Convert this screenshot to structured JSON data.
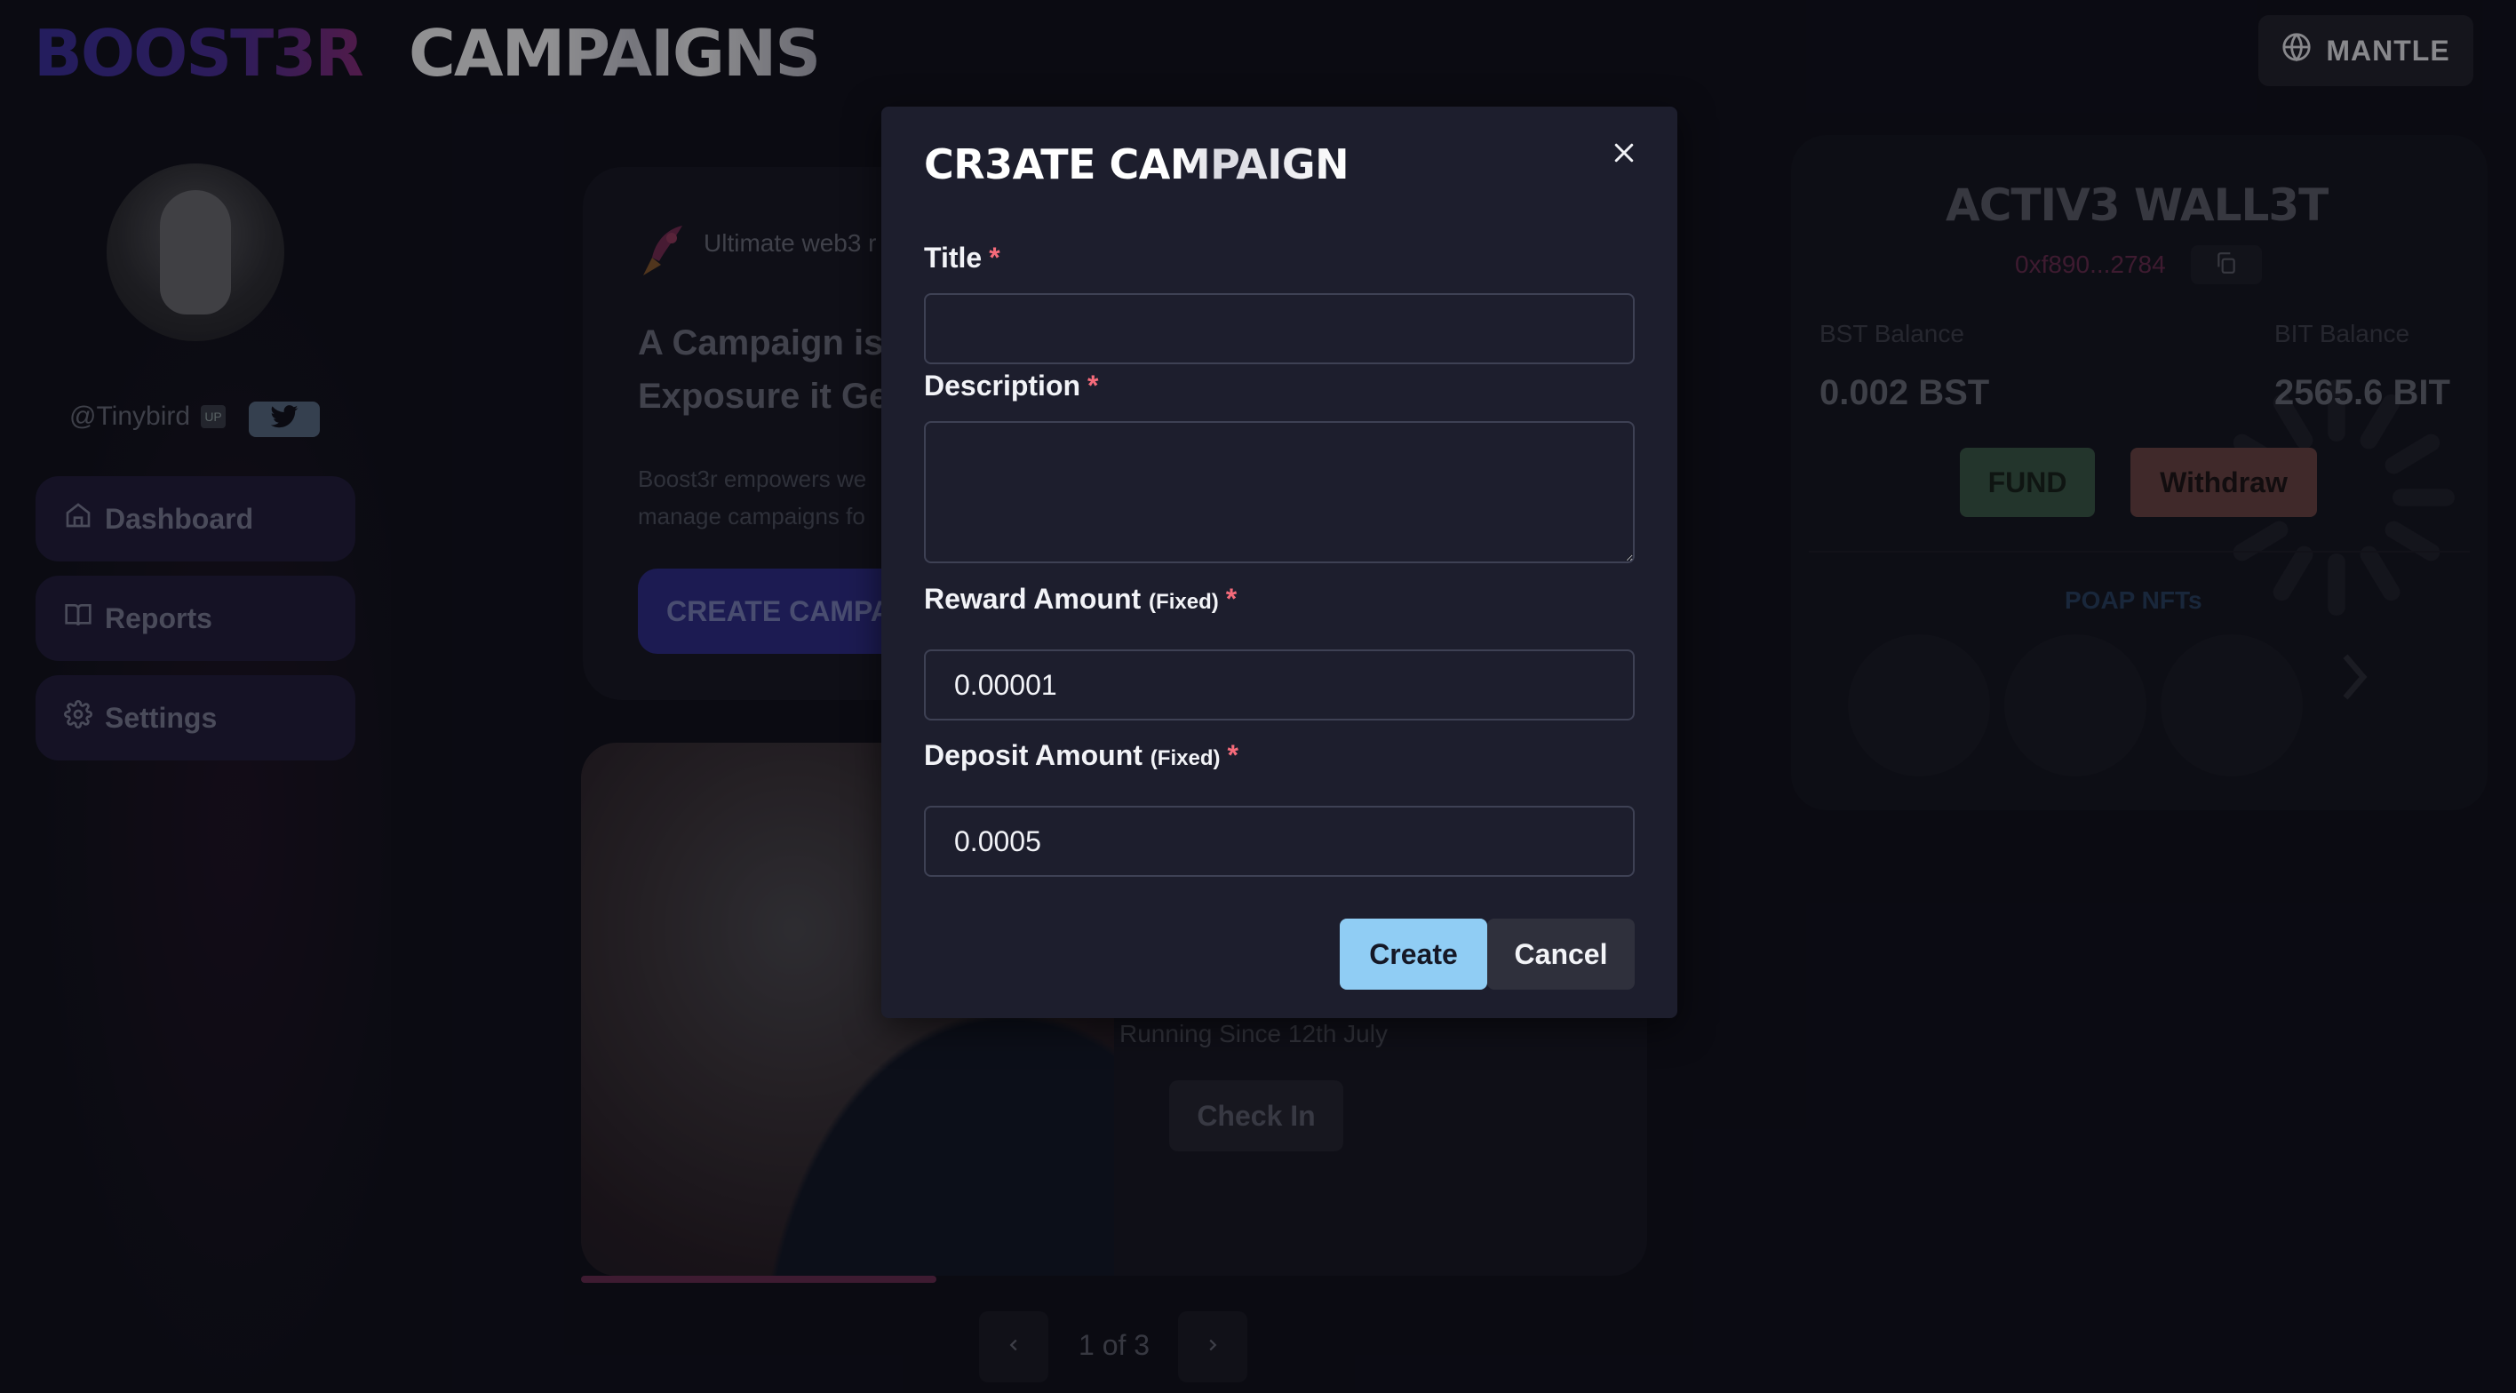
{
  "header": {
    "brand": "BOOST3R",
    "page_title": "CAMPAIGNS",
    "network_label": "MANTLE"
  },
  "profile": {
    "handle": "@Tinybird",
    "handle_badge": "UP"
  },
  "sidebar": {
    "items": [
      {
        "label": "Dashboard",
        "icon": "home-icon"
      },
      {
        "label": "Reports",
        "icon": "book-icon"
      },
      {
        "label": "Settings",
        "icon": "gear-icon"
      }
    ]
  },
  "hero": {
    "tagline": "Ultimate web3 r",
    "title_line1": "A Campaign is",
    "title_line2": "Exposure it Ge",
    "desc_line1": "Boost3r empowers we",
    "desc_line2": "manage campaigns fo",
    "cta": "CREATE CAMPA"
  },
  "campaign_card": {
    "since": "Running Since 12th July",
    "check_in": "Check In",
    "progress_fraction": 0.333
  },
  "pager": {
    "text": "1 of 3"
  },
  "wallet": {
    "title": "ACTIV3 WALL3T",
    "address": "0xf890...2784",
    "bst_label": "BST Balance",
    "bst_value": "0.002 BST",
    "bit_label": "BIT Balance",
    "bit_value": "2565.6 BIT",
    "fund": "FUND",
    "withdraw": "Withdraw",
    "poap_label": "POAP NFTs"
  },
  "modal": {
    "title": "CR3ATE CAMPAIGN",
    "title_label": "Title",
    "title_value": "",
    "description_label": "Description",
    "description_value": "",
    "reward_label": "Reward Amount",
    "reward_suffix": "(Fixed)",
    "reward_value": "0.00001",
    "deposit_label": "Deposit Amount",
    "deposit_suffix": "(Fixed)",
    "deposit_value": "0.0005",
    "required_mark": "*",
    "create": "Create",
    "cancel": "Cancel"
  },
  "colors": {
    "accent_primary": "#90cdf4",
    "required": "#f56b7a",
    "modal_bg": "#1d1e2d",
    "page_bg": "#0d0e17"
  }
}
